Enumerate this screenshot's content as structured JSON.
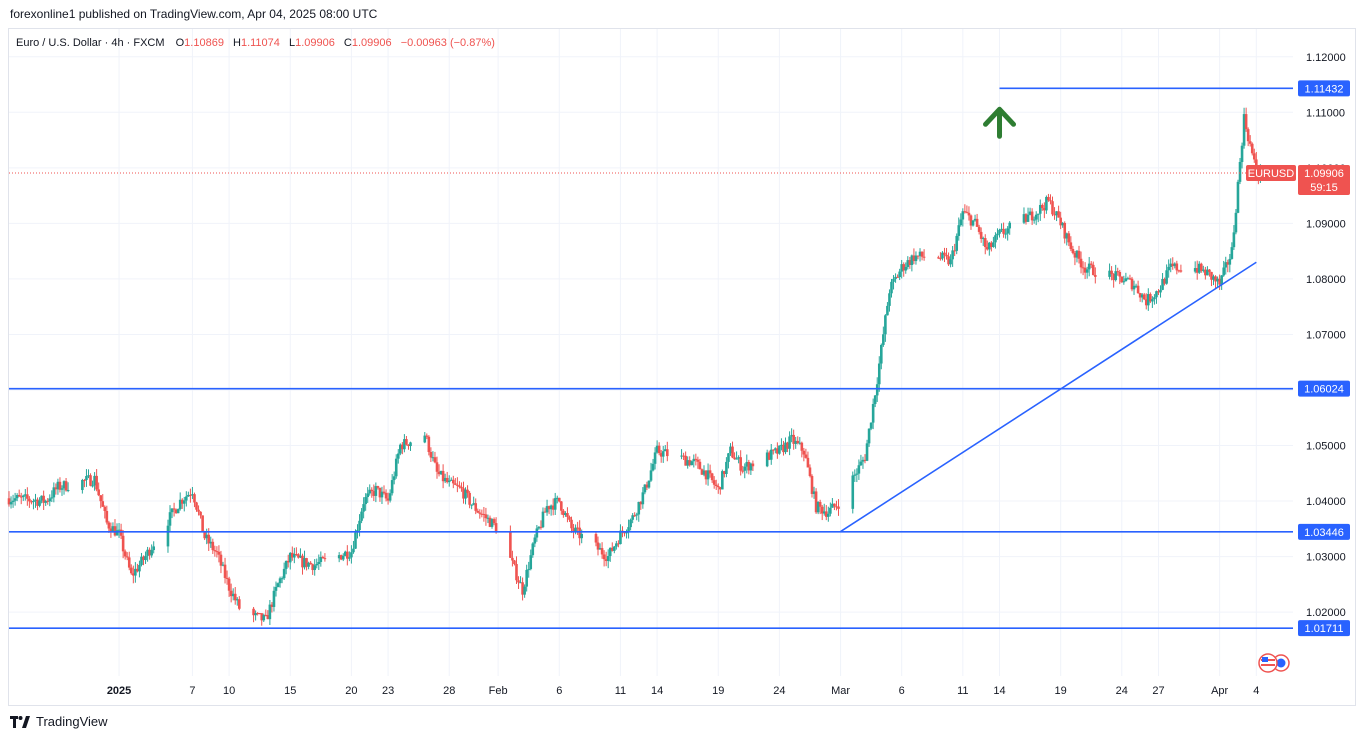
{
  "header": {
    "publish_text": "forexonline1 published on TradingView.com, Apr 04, 2025 08:00 UTC"
  },
  "legend": {
    "symbol": "Euro / U.S. Dollar · 4h · FXCM",
    "o_label": "O",
    "o_value": "1.10869",
    "h_label": "H",
    "h_value": "1.11074",
    "l_label": "L",
    "l_value": "1.09906",
    "c_label": "C",
    "c_value": "1.09906",
    "change": "−0.00963 (−0.87%)"
  },
  "footer": {
    "brand": "TradingView"
  },
  "colors": {
    "up": "#26a69a",
    "down": "#ef5350",
    "line": "#2962ff",
    "grid": "#f0f3fa",
    "arrow": "#2e7d32",
    "text": "#131722",
    "axis_text": "#131722"
  },
  "chart_data": {
    "type": "candlestick",
    "symbol": "EURUSD",
    "ylim": [
      1.0085,
      1.125
    ],
    "y_ticks": [
      "1.12000",
      "1.11000",
      "1.10000",
      "1.09000",
      "1.08000",
      "1.07000",
      "1.06000",
      "1.05000",
      "1.04000",
      "1.03000",
      "1.02000"
    ],
    "x_ticks": [
      {
        "label": "2025",
        "date": "2025-01-01",
        "bold": true
      },
      {
        "label": "7",
        "date": "2025-01-07"
      },
      {
        "label": "10",
        "date": "2025-01-10"
      },
      {
        "label": "15",
        "date": "2025-01-15"
      },
      {
        "label": "20",
        "date": "2025-01-20"
      },
      {
        "label": "23",
        "date": "2025-01-23"
      },
      {
        "label": "28",
        "date": "2025-01-28"
      },
      {
        "label": "Feb",
        "date": "2025-02-01"
      },
      {
        "label": "6",
        "date": "2025-02-06"
      },
      {
        "label": "11",
        "date": "2025-02-11"
      },
      {
        "label": "14",
        "date": "2025-02-14"
      },
      {
        "label": "19",
        "date": "2025-02-19"
      },
      {
        "label": "24",
        "date": "2025-02-24"
      },
      {
        "label": "Mar",
        "date": "2025-03-01"
      },
      {
        "label": "6",
        "date": "2025-03-06"
      },
      {
        "label": "11",
        "date": "2025-03-11"
      },
      {
        "label": "14",
        "date": "2025-03-14"
      },
      {
        "label": "19",
        "date": "2025-03-19"
      },
      {
        "label": "24",
        "date": "2025-03-24"
      },
      {
        "label": "27",
        "date": "2025-03-27"
      },
      {
        "label": "Apr",
        "date": "2025-04-01"
      },
      {
        "label": "4",
        "date": "2025-04-04"
      }
    ],
    "price_path": [
      [
        "2024-12-23",
        1.0405
      ],
      [
        "2024-12-26",
        1.04
      ],
      [
        "2024-12-27",
        1.0425
      ],
      [
        "2024-12-30",
        1.044
      ],
      [
        "2024-12-31",
        1.036
      ],
      [
        "2025-01-01",
        1.034
      ],
      [
        "2025-01-02",
        1.0265
      ],
      [
        "2025-01-03",
        1.0295
      ],
      [
        "2025-01-06",
        1.04
      ],
      [
        "2025-01-07",
        1.042
      ],
      [
        "2025-01-08",
        1.0335
      ],
      [
        "2025-01-09",
        1.0305
      ],
      [
        "2025-01-10",
        1.0245
      ],
      [
        "2025-01-11",
        1.02
      ],
      [
        "2025-01-13",
        1.0185
      ],
      [
        "2025-01-14",
        1.025
      ],
      [
        "2025-01-15",
        1.03
      ],
      [
        "2025-01-16",
        1.029
      ],
      [
        "2025-01-17",
        1.0285
      ],
      [
        "2025-01-20",
        1.031
      ],
      [
        "2025-01-21",
        1.04
      ],
      [
        "2025-01-22",
        1.042
      ],
      [
        "2025-01-23",
        1.04
      ],
      [
        "2025-01-24",
        1.05
      ],
      [
        "2025-01-26",
        1.052
      ],
      [
        "2025-01-27",
        1.045
      ],
      [
        "2025-01-28",
        1.043
      ],
      [
        "2025-01-29",
        1.042
      ],
      [
        "2025-01-30",
        1.039
      ],
      [
        "2025-01-31",
        1.037
      ],
      [
        "2025-02-01",
        1.035
      ],
      [
        "2025-02-03",
        1.024
      ],
      [
        "2025-02-04",
        1.033
      ],
      [
        "2025-02-05",
        1.039
      ],
      [
        "2025-02-06",
        1.04
      ],
      [
        "2025-02-07",
        1.035
      ],
      [
        "2025-02-10",
        1.03
      ],
      [
        "2025-02-11",
        1.034
      ],
      [
        "2025-02-12",
        1.037
      ],
      [
        "2025-02-13",
        1.042
      ],
      [
        "2025-02-14",
        1.049
      ],
      [
        "2025-02-17",
        1.047
      ],
      [
        "2025-02-18",
        1.045
      ],
      [
        "2025-02-19",
        1.042
      ],
      [
        "2025-02-20",
        1.049
      ],
      [
        "2025-02-21",
        1.046
      ],
      [
        "2025-02-24",
        1.049
      ],
      [
        "2025-02-25",
        1.051
      ],
      [
        "2025-02-26",
        1.049
      ],
      [
        "2025-02-27",
        1.039
      ],
      [
        "2025-02-28",
        1.038
      ],
      [
        "2025-03-01",
        1.04
      ],
      [
        "2025-03-03",
        1.048
      ],
      [
        "2025-03-04",
        1.062
      ],
      [
        "2025-03-05",
        1.078
      ],
      [
        "2025-03-06",
        1.082
      ],
      [
        "2025-03-07",
        1.084
      ],
      [
        "2025-03-09",
        1.084
      ],
      [
        "2025-03-10",
        1.083
      ],
      [
        "2025-03-11",
        1.092
      ],
      [
        "2025-03-12",
        1.09
      ],
      [
        "2025-03-13",
        1.085
      ],
      [
        "2025-03-14",
        1.088
      ],
      [
        "2025-03-17",
        1.092
      ],
      [
        "2025-03-18",
        1.094
      ],
      [
        "2025-03-19",
        1.09
      ],
      [
        "2025-03-20",
        1.085
      ],
      [
        "2025-03-21",
        1.082
      ],
      [
        "2025-03-24",
        1.08
      ],
      [
        "2025-03-25",
        1.079
      ],
      [
        "2025-03-26",
        1.076
      ],
      [
        "2025-03-27",
        1.078
      ],
      [
        "2025-03-28",
        1.082
      ],
      [
        "2025-03-30",
        1.082
      ],
      [
        "2025-03-31",
        1.081
      ],
      [
        "2025-04-01",
        1.079
      ],
      [
        "2025-04-02",
        1.085
      ],
      [
        "2025-04-03",
        1.109
      ],
      [
        "2025-04-04",
        1.0991
      ]
    ],
    "horizontal_levels": [
      {
        "label": "1.11432",
        "value": 1.11432,
        "start_date": "2025-03-14"
      },
      {
        "label": "1.06024",
        "value": 1.06024
      },
      {
        "label": "1.03446",
        "value": 1.03446
      },
      {
        "label": "1.01711",
        "value": 1.01711
      }
    ],
    "trendline": {
      "start": [
        "2025-03-01",
        1.0345
      ],
      "end": [
        "2025-04-04",
        1.083
      ]
    },
    "arrow": {
      "date": "2025-03-14",
      "value": 1.11,
      "direction": "up"
    },
    "current_price": {
      "label": "EURUSD",
      "value": 1.09906,
      "value_label": "1.09906",
      "countdown": "59:15"
    },
    "candle_interval": "4h",
    "axis_range": {
      "start": "2024-12-23",
      "end": "2025-04-07"
    }
  }
}
